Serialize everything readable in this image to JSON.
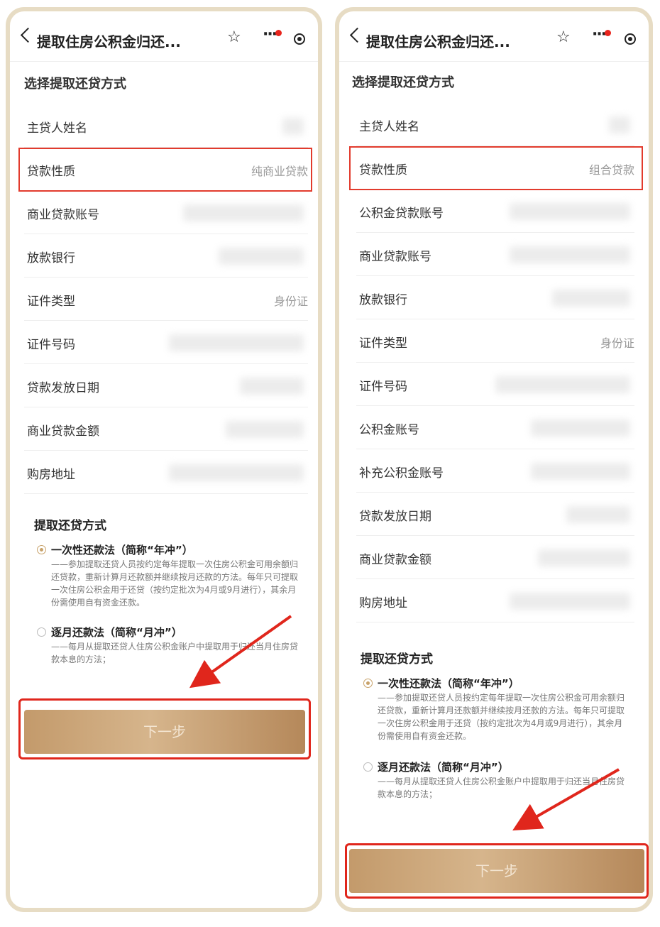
{
  "left": {
    "nav_title": "提取住房公积金归还...",
    "section_title": "选择提取还贷方式",
    "fields": [
      {
        "label": "主贷人姓名",
        "value": ""
      },
      {
        "label": "贷款性质",
        "value": "纯商业贷款"
      },
      {
        "label": "商业贷款账号",
        "value": ""
      },
      {
        "label": "放款银行",
        "value": ""
      },
      {
        "label": "证件类型",
        "value": "身份证"
      },
      {
        "label": "证件号码",
        "value": ""
      },
      {
        "label": "贷款发放日期",
        "value": ""
      },
      {
        "label": "商业贷款金额",
        "value": ""
      },
      {
        "label": "购房地址",
        "value": ""
      }
    ],
    "method_title": "提取还贷方式",
    "options": [
      {
        "title": "一次性还款法（简称“年冲”）",
        "desc": "——参加提取还贷人员按约定每年提取一次住房公积金可用余额归还贷款，重新计算月还款额并继续按月还款的方法。每年只可提取一次住房公积金用于还贷（按约定批次为4月或9月进行），其余月份需使用自有资金还款。",
        "checked": true
      },
      {
        "title": "逐月还款法（简称“月冲”）",
        "desc": "——每月从提取还贷人住房公积金账户中提取用于归还当月住房贷款本息的方法；",
        "checked": false
      }
    ],
    "next_button": "下一步"
  },
  "right": {
    "nav_title": "提取住房公积金归还...",
    "section_title": "选择提取还贷方式",
    "fields": [
      {
        "label": "主贷人姓名",
        "value": ""
      },
      {
        "label": "贷款性质",
        "value": "组合贷款"
      },
      {
        "label": "公积金贷款账号",
        "value": ""
      },
      {
        "label": "商业贷款账号",
        "value": ""
      },
      {
        "label": "放款银行",
        "value": ""
      },
      {
        "label": "证件类型",
        "value": "身份证"
      },
      {
        "label": "证件号码",
        "value": ""
      },
      {
        "label": "公积金账号",
        "value": ""
      },
      {
        "label": "补充公积金账号",
        "value": ""
      },
      {
        "label": "贷款发放日期",
        "value": ""
      },
      {
        "label": "商业贷款金额",
        "value": ""
      },
      {
        "label": "购房地址",
        "value": ""
      }
    ],
    "method_title": "提取还贷方式",
    "options": [
      {
        "title": "一次性还款法（简称“年冲”）",
        "desc": "——参加提取还贷人员按约定每年提取一次住房公积金可用余额归还贷款，重新计算月还款额并继续按月还款的方法。每年只可提取一次住房公积金用于还贷（按约定批次为4月或9月进行），其余月份需使用自有资金还款。",
        "checked": true
      },
      {
        "title": "逐月还款法（简称“月冲”）",
        "desc": "——每月从提取还贷人住房公积金账户中提取用于归还当月住房贷款本息的方法；",
        "checked": false
      }
    ],
    "next_button": "下一步"
  },
  "colors": {
    "accent_gold": "#c8a26a",
    "highlight_red": "#e23b2d",
    "frame_beige": "#e7dcc4"
  },
  "icons": {
    "back": "chevron-left-icon",
    "star": "star-icon",
    "more": "more-dots-icon",
    "record": "record-circle-icon"
  }
}
